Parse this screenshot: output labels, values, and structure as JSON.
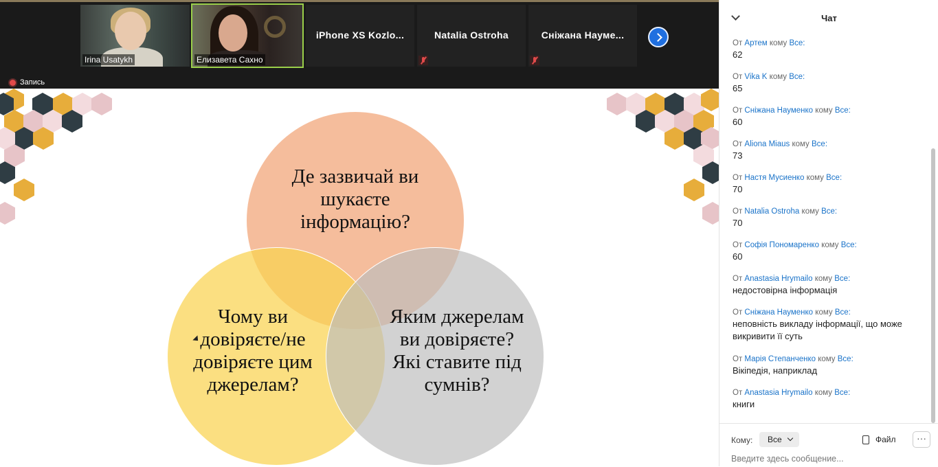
{
  "participants": [
    {
      "name": "Irina Usatykh",
      "type": "video"
    },
    {
      "name": "Елизавета Сахно",
      "type": "video",
      "active": true
    },
    {
      "name": "iPhone XS Kozlo...",
      "type": "name"
    },
    {
      "name": "Natalia Ostroha",
      "type": "name",
      "muted": true
    },
    {
      "name": "Сніжана Науме...",
      "type": "name",
      "muted": true
    }
  ],
  "recording": {
    "label": "Запись"
  },
  "slide": {
    "top_circle": "Де зазвичай ви шукаєте інформацію?",
    "left_circle": "Чому ви довіряєте/не довіряєте цим джерелам?",
    "right_circle": "Яким джерелам ви довіряєте? Які ставите під сумнів?"
  },
  "chat": {
    "title": "Чат",
    "from_word": "От",
    "to_word": "кому",
    "to_target": "Все:",
    "messages": [
      {
        "from": "Артем",
        "text": "62"
      },
      {
        "from": "Vika K",
        "text": "65"
      },
      {
        "from": "Сніжана Науменко",
        "text": "60"
      },
      {
        "from": "Aliona Miaus",
        "text": "73"
      },
      {
        "from": "Настя Мусиенко",
        "text": "70"
      },
      {
        "from": "Natalia Ostroha",
        "text": "70"
      },
      {
        "from": "Софія Пономаренко",
        "text": "60"
      },
      {
        "from": "Anastasia Hrymailo",
        "text": "недостовірна інформація"
      },
      {
        "from": "Сніжана Науменко",
        "text": "неповність викладу інформації, що може викривити її суть"
      },
      {
        "from": "Марія Степанченко",
        "text": "Вікіпедія, наприклад"
      },
      {
        "from": "Anastasia Hrymailo",
        "text": "книги"
      }
    ],
    "to_label": "Кому:",
    "to_value": "Все",
    "file_label": "Файл",
    "more_label": "···",
    "input_placeholder": "Введите здесь сообщение..."
  },
  "colors": {
    "accent": "#1a73c9",
    "next_button": "#1f6fe0",
    "active_border": "#9bd04a"
  }
}
